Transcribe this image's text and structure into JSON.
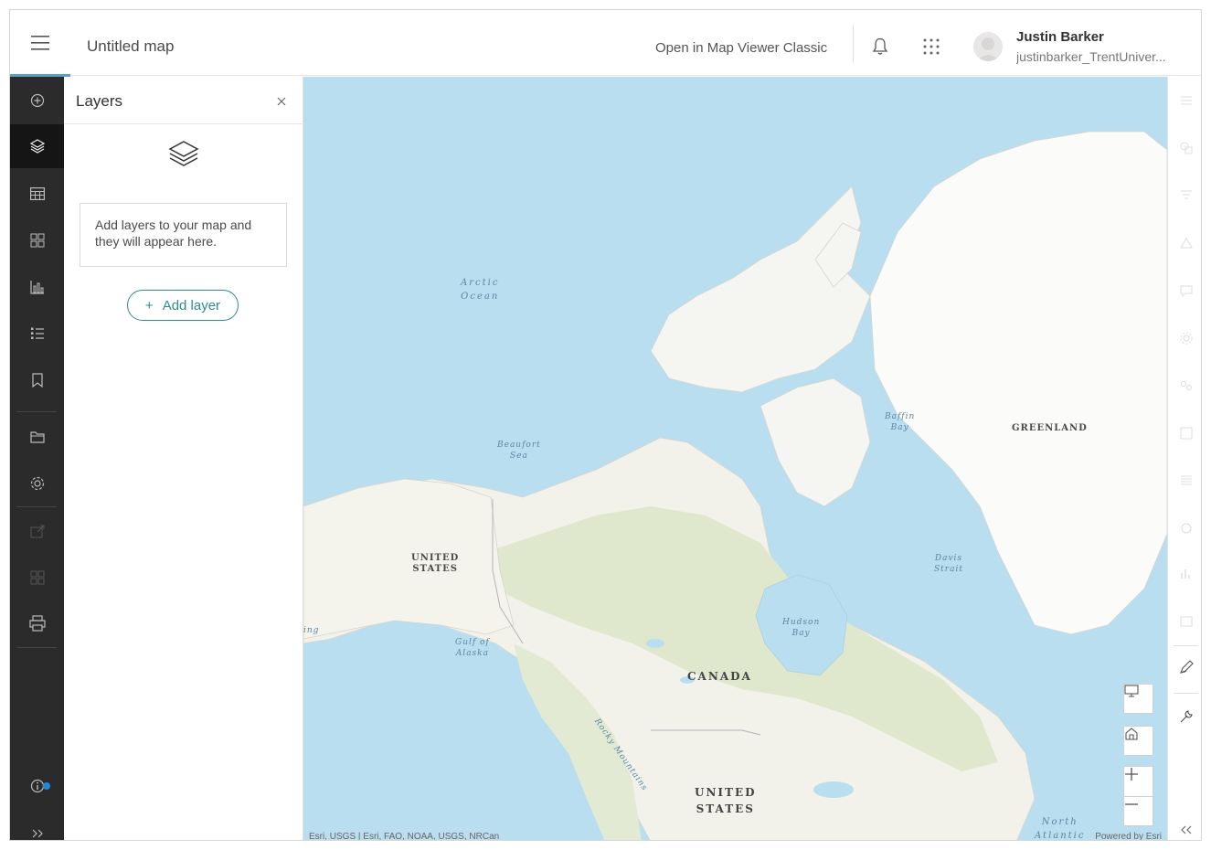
{
  "header": {
    "title": "Untitled map",
    "open_classic_label": "Open in Map Viewer Classic",
    "user_name": "Justin Barker",
    "user_handle": "justinbarker_TrentUniver..."
  },
  "left_toolbar": {
    "items": [
      "add-icon",
      "layers-icon",
      "table-icon",
      "basemap-icon",
      "chart-icon",
      "legend-icon",
      "bookmark-icon",
      "folder-icon",
      "settings-icon",
      "share-icon",
      "grid-icon",
      "print-icon",
      "info-icon",
      "expand-icon"
    ]
  },
  "panel": {
    "title": "Layers",
    "empty_message": "Add layers to your map and they will appear here.",
    "add_layer_label": "Add layer"
  },
  "map": {
    "labels": {
      "arctic_ocean_1": "Arctic",
      "arctic_ocean_2": "Ocean",
      "beaufort_1": "Beaufort",
      "beaufort_2": "Sea",
      "baffin_1": "Baffin",
      "baffin_2": "Bay",
      "greenland": "GREENLAND",
      "us_alaska_1": "UNITED",
      "us_alaska_2": "STATES",
      "davis_1": "Davis",
      "davis_2": "Strait",
      "hudson_1": "Hudson",
      "hudson_2": "Bay",
      "gulf_alaska_1": "Gulf of",
      "gulf_alaska_2": "Alaska",
      "canada": "CANADA",
      "rocky": "Rocky Mountains",
      "us_main_1": "UNITED",
      "us_main_2": "STATES",
      "north_atlantic_1": "North",
      "north_atlantic_2": "Atlantic",
      "bering": "ing"
    },
    "attribution": "Esri, USGS | Esri, FAO, NOAA, USGS, NRCan",
    "powered_by": "Powered by Esri",
    "colors": {
      "water": "#b9def0",
      "land": "#f4f3ec",
      "forest": "#dfe8cc",
      "ice": "#fbfbfa"
    }
  },
  "right_toolbar": {
    "items": [
      "properties-icon",
      "styles-icon",
      "filter-icon",
      "effects-icon",
      "pop-ups-icon",
      "configure-icon",
      "clustering-icon",
      "labels-icon",
      "fields-icon",
      "analysis-icon",
      "sketch-icon",
      "measure-icon",
      "collapse-icon"
    ]
  }
}
